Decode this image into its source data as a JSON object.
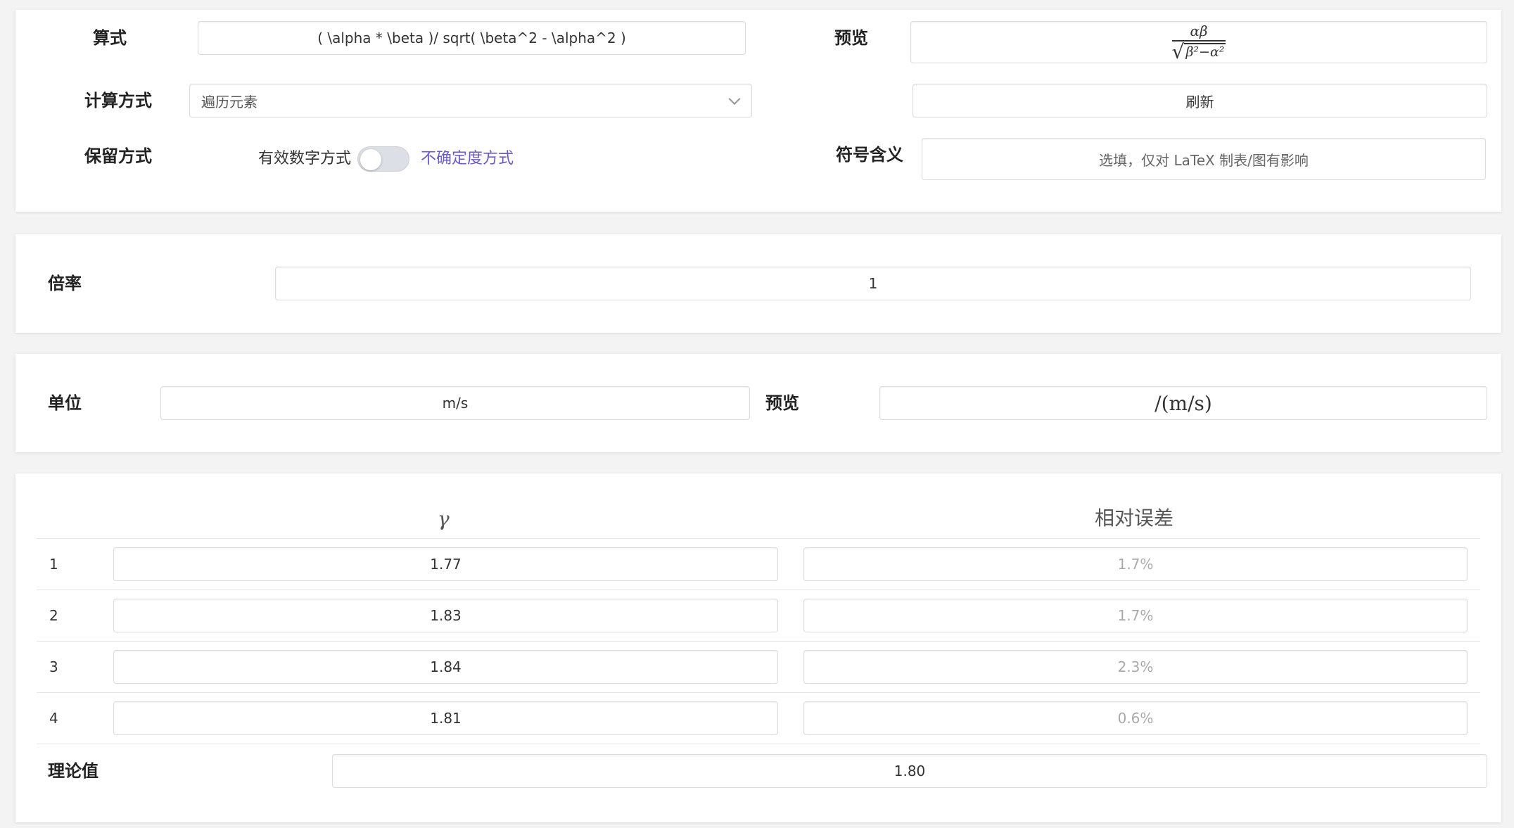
{
  "formula": {
    "label": "算式",
    "value": "( \\alpha *  \\beta )/ sqrt(  \\beta^2 - \\alpha^2 )",
    "preview_label": "预览",
    "preview_num": "αβ",
    "preview_den": "β²−α²"
  },
  "calc_method": {
    "label": "计算方式",
    "selected": "遍历元素",
    "refresh_label": "刷新"
  },
  "retention": {
    "label": "保留方式",
    "left_option": "有效数字方式",
    "right_option": "不确定度方式",
    "toggle_on": false,
    "active_color": "#6a5acd"
  },
  "symbol_meaning": {
    "label": "符号含义",
    "placeholder": "选填，仅对 LaTeX 制表/图有影响"
  },
  "multiplier": {
    "label": "倍率",
    "value": "1"
  },
  "unit": {
    "label": "单位",
    "value": "m/s",
    "preview_label": "预览",
    "preview_value": "/(m/s)"
  },
  "table": {
    "columns": [
      "γ",
      "相对误差"
    ],
    "rows": [
      {
        "index": "1",
        "value": "1.77",
        "error": "1.7%"
      },
      {
        "index": "2",
        "value": "1.83",
        "error": "1.7%"
      },
      {
        "index": "3",
        "value": "1.84",
        "error": "2.3%"
      },
      {
        "index": "4",
        "value": "1.81",
        "error": "0.6%"
      }
    ],
    "theory_label": "理论值",
    "theory_value": "1.80"
  }
}
